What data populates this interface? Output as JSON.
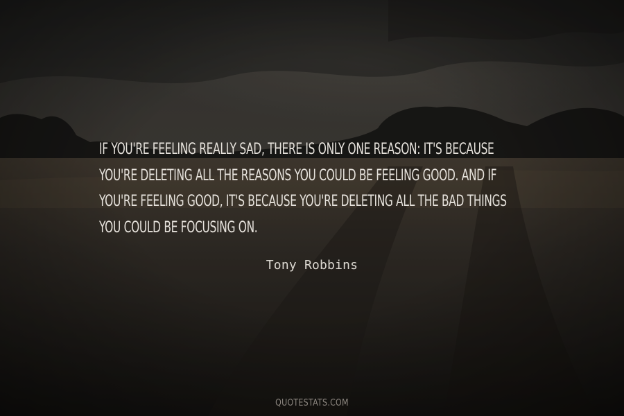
{
  "quote": {
    "lines": [
      "If you're feeling really sad, there is only one reason: it's because",
      "you're deleting all the reasons you could be feeling good. And if",
      "you're feeling good, it's because you're deleting all the bad things",
      "you could be focusing on."
    ]
  },
  "author": "Tony Robbins",
  "watermark": "QUOTESTATS.COM",
  "colors": {
    "text": "#e6e2dc",
    "sky": "#3b3a37",
    "field": "#2b2620"
  }
}
